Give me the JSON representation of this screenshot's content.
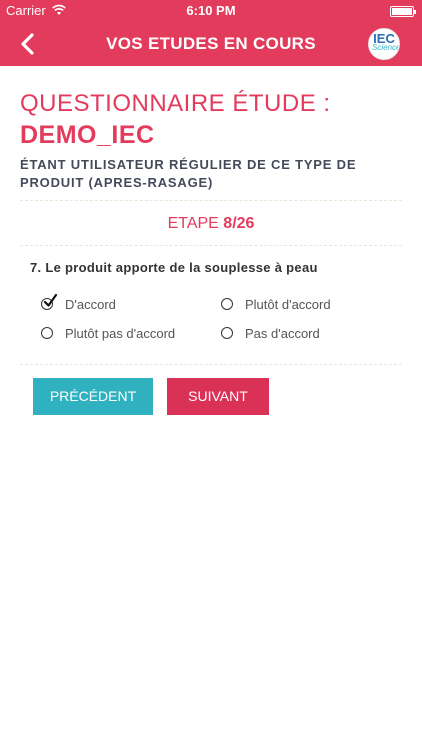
{
  "status_bar": {
    "carrier": "Carrier",
    "time": "6:10 PM"
  },
  "nav": {
    "title": "VOS ETUDES EN COURS",
    "logo_text": "IEC",
    "logo_sub": "Science"
  },
  "questionnaire": {
    "label": "QUESTIONNAIRE ÉTUDE :",
    "name": "DEMO_IEC",
    "description": "ÉTANT UTILISATEUR RÉGULIER DE CE TYPE DE PRODUIT (APRES-RASAGE)"
  },
  "step": {
    "label": "ETAPE",
    "value": "8/26"
  },
  "question": {
    "text": "7. Le produit apporte de la souplesse à peau",
    "options": [
      {
        "label": "D'accord",
        "selected": true
      },
      {
        "label": "Plutôt d'accord",
        "selected": false
      },
      {
        "label": "Plutôt pas d'accord",
        "selected": false
      },
      {
        "label": "Pas d'accord",
        "selected": false
      }
    ]
  },
  "buttons": {
    "previous": "PRÉCÉDENT",
    "next": "SUIVANT"
  },
  "colors": {
    "brand": "#e33b5c",
    "previous_button": "#2fb1bf",
    "next_button": "#d93256"
  }
}
